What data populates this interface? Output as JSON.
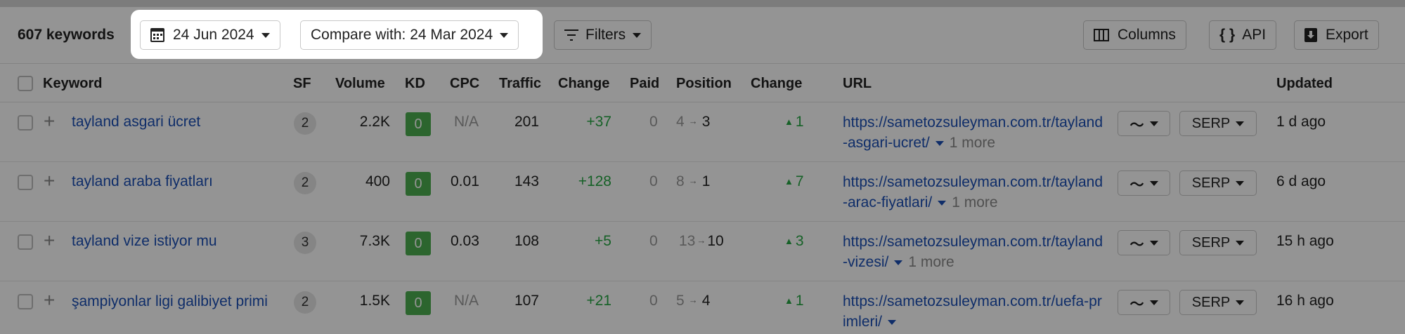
{
  "toolbar": {
    "keyword_count": "607 keywords",
    "date_label": "24 Jun 2024",
    "compare_label": "Compare with: 24 Mar 2024",
    "filters_label": "Filters",
    "columns_label": "Columns",
    "api_label": "API",
    "export_label": "Export"
  },
  "columns": {
    "keyword": "Keyword",
    "sf": "SF",
    "volume": "Volume",
    "kd": "KD",
    "cpc": "CPC",
    "traffic": "Traffic",
    "change": "Change",
    "paid": "Paid",
    "position": "Position",
    "pos_change": "Change",
    "url": "URL",
    "updated": "Updated"
  },
  "rows": [
    {
      "keyword": "tayland asgari ücret",
      "sf": "2",
      "volume": "2.2K",
      "kd": "0",
      "cpc": "N/A",
      "traffic": "201",
      "change": "+37",
      "paid": "0",
      "pos_from": "4",
      "pos_to": "3",
      "pos_change": "1",
      "url": "https://sametozsuleyman.com.tr/tayland-asgari-ucret/",
      "more": "1 more",
      "serp": "SERP",
      "updated": "1 d ago"
    },
    {
      "keyword": "tayland araba fiyatları",
      "sf": "2",
      "volume": "400",
      "kd": "0",
      "cpc": "0.01",
      "traffic": "143",
      "change": "+128",
      "paid": "0",
      "pos_from": "8",
      "pos_to": "1",
      "pos_change": "7",
      "url": "https://sametozsuleyman.com.tr/tayland-arac-fiyatlari/",
      "more": "1 more",
      "serp": "SERP",
      "updated": "6 d ago"
    },
    {
      "keyword": "tayland vize istiyor mu",
      "sf": "3",
      "volume": "7.3K",
      "kd": "0",
      "cpc": "0.03",
      "traffic": "108",
      "change": "+5",
      "paid": "0",
      "pos_from": "13",
      "pos_to": "10",
      "pos_change": "3",
      "url": "https://sametozsuleyman.com.tr/tayland-vizesi/",
      "more": "1 more",
      "serp": "SERP",
      "updated": "15 h ago"
    },
    {
      "keyword": "şampiyonlar ligi galibiyet primi",
      "sf": "2",
      "volume": "1.5K",
      "kd": "0",
      "cpc": "N/A",
      "traffic": "107",
      "change": "+21",
      "paid": "0",
      "pos_from": "5",
      "pos_to": "4",
      "pos_change": "1",
      "url": "https://sametozsuleyman.com.tr/uefa-primleri/",
      "more": "",
      "serp": "SERP",
      "updated": "16 h ago"
    }
  ],
  "colors": {
    "link": "#1a4fb5",
    "positive": "#27a844",
    "kd_badge": "#4caf50",
    "overlay": "rgba(0,0,0,0.42)"
  }
}
